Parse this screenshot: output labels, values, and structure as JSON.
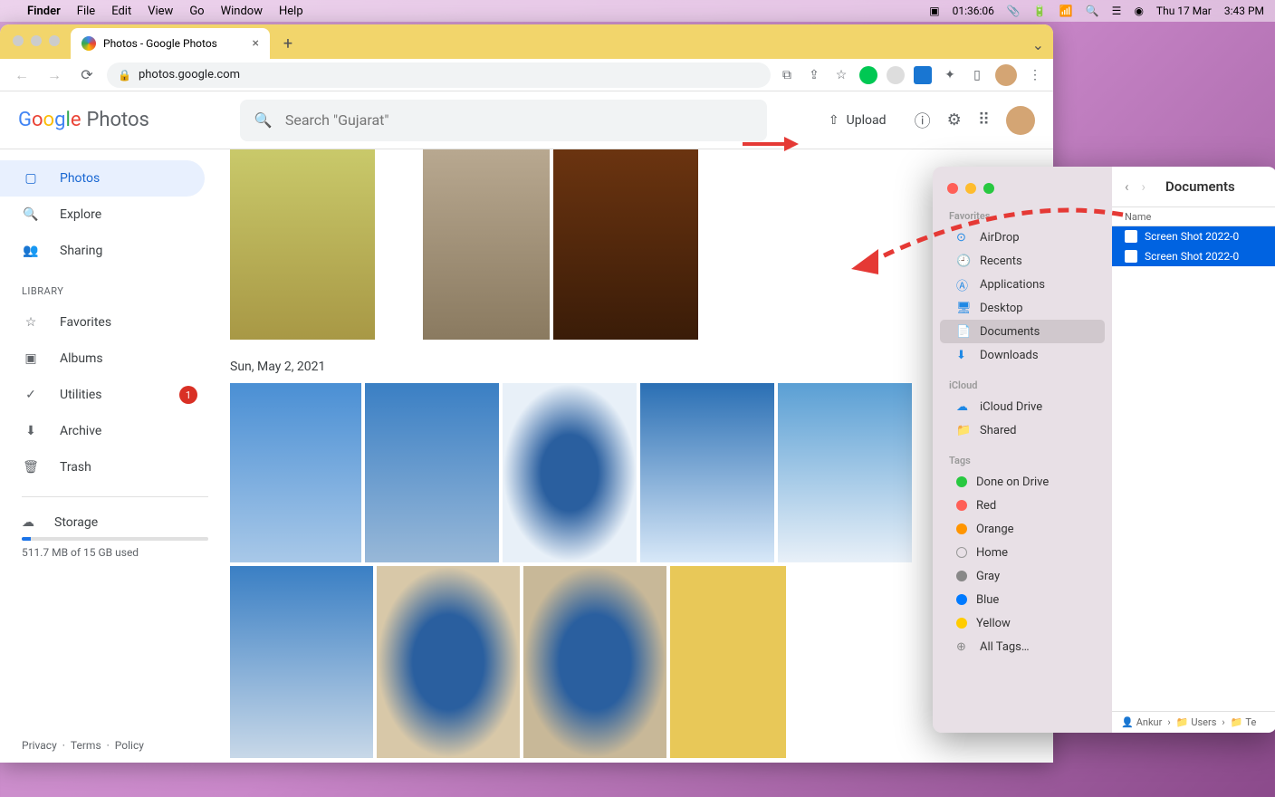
{
  "menubar": {
    "app": "Finder",
    "items": [
      "File",
      "Edit",
      "View",
      "Go",
      "Window",
      "Help"
    ],
    "clock": "01:36:06",
    "date": "Thu 17 Mar",
    "time": "3:43 PM"
  },
  "chrome": {
    "tab_title": "Photos - Google Photos",
    "url": "photos.google.com"
  },
  "gp": {
    "logo_text": "Photos",
    "search_placeholder": "Search \"Gujarat\"",
    "upload_label": "Upload",
    "sidebar": {
      "photos": "Photos",
      "explore": "Explore",
      "sharing": "Sharing",
      "library_label": "LIBRARY",
      "favorites": "Favorites",
      "albums": "Albums",
      "utilities": "Utilities",
      "utilities_badge": "1",
      "archive": "Archive",
      "trash": "Trash"
    },
    "storage": {
      "label": "Storage",
      "text": "511.7 MB of 15 GB used"
    },
    "footer": {
      "privacy": "Privacy",
      "terms": "Terms",
      "policy": "Policy"
    },
    "date_header": "Sun, May 2, 2021"
  },
  "finder": {
    "title": "Documents",
    "col_name": "Name",
    "sections": {
      "favorites": "Favorites",
      "icloud": "iCloud",
      "tags": "Tags"
    },
    "fav_items": {
      "airdrop": "AirDrop",
      "recents": "Recents",
      "applications": "Applications",
      "desktop": "Desktop",
      "documents": "Documents",
      "downloads": "Downloads"
    },
    "icloud_items": {
      "drive": "iCloud Drive",
      "shared": "Shared"
    },
    "tag_items": {
      "done": "Done on Drive",
      "red": "Red",
      "orange": "Orange",
      "home": "Home",
      "gray": "Gray",
      "blue": "Blue",
      "yellow": "Yellow",
      "all": "All Tags…"
    },
    "files": [
      "Screen Shot 2022-0",
      "Screen Shot 2022-0"
    ],
    "path": {
      "user": "Ankur",
      "users": "Users",
      "last": "Te"
    }
  }
}
